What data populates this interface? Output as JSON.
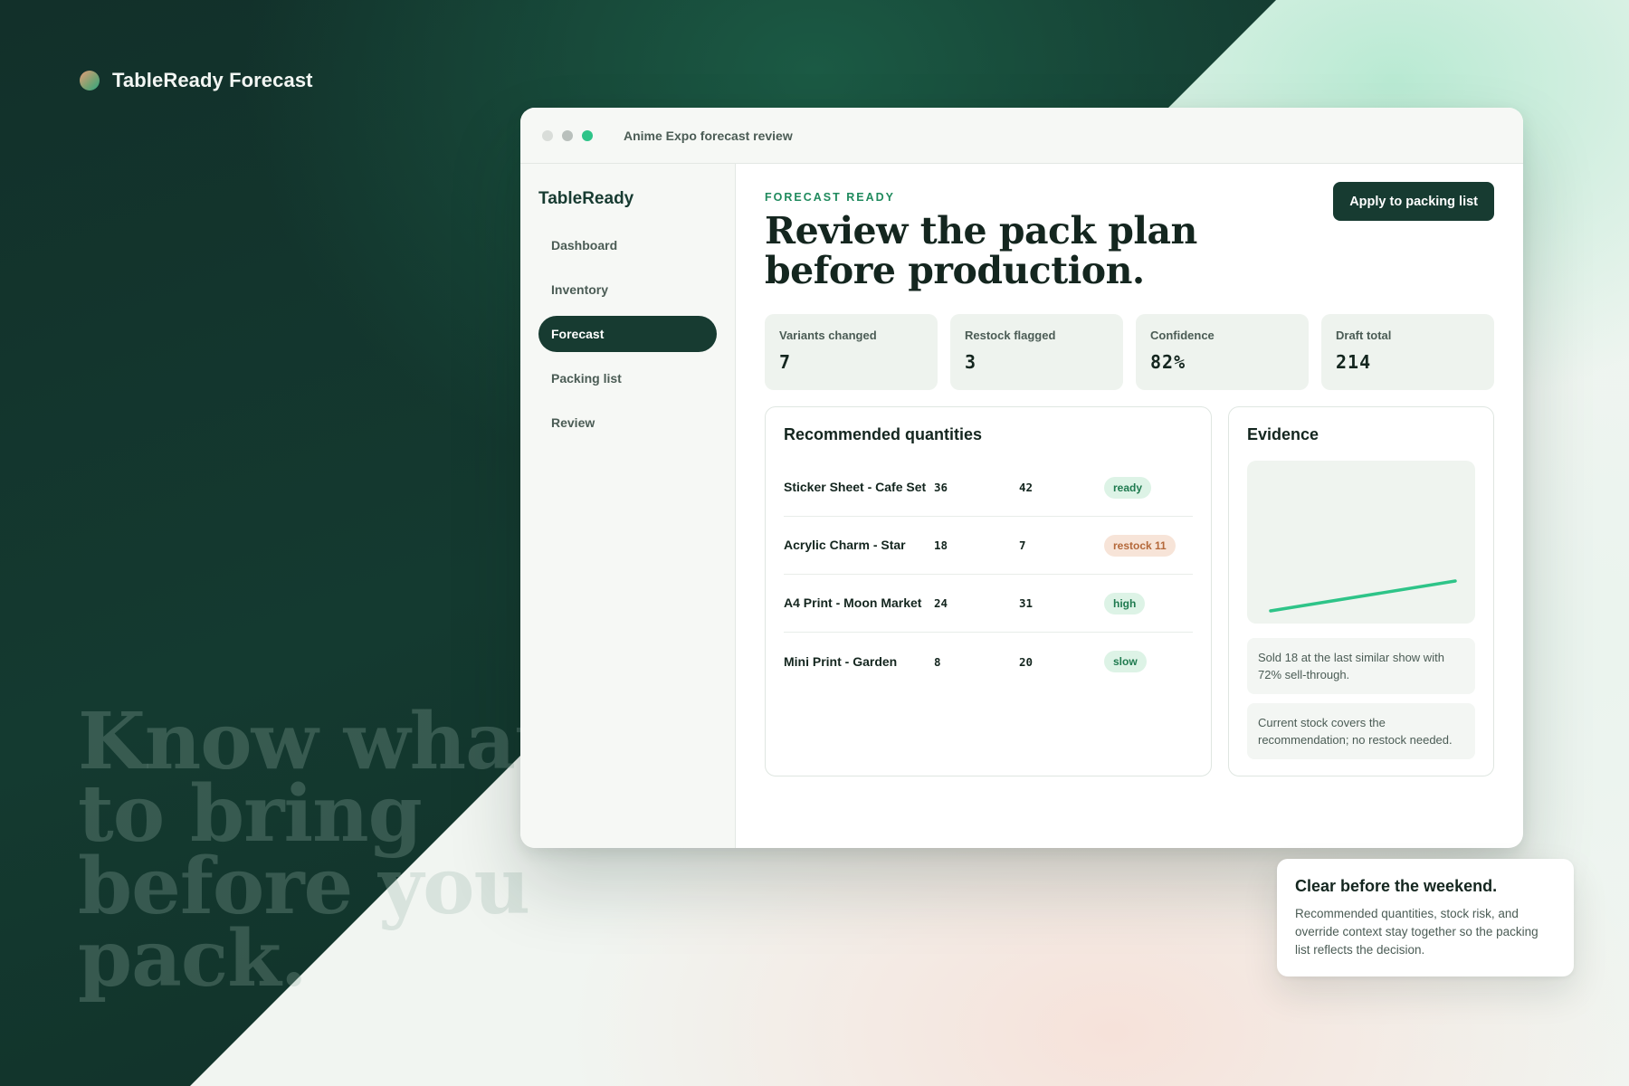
{
  "brand": {
    "name": "TableReady Forecast"
  },
  "hero": {
    "lines": [
      "Know what",
      "to bring",
      "before you",
      "pack."
    ]
  },
  "window": {
    "title": "Anime Expo forecast review"
  },
  "sidebar": {
    "brand": "TableReady",
    "items": [
      {
        "label": "Dashboard",
        "active": false
      },
      {
        "label": "Inventory",
        "active": false
      },
      {
        "label": "Forecast",
        "active": true
      },
      {
        "label": "Packing list",
        "active": false
      },
      {
        "label": "Review",
        "active": false
      }
    ]
  },
  "main": {
    "eyebrow": "FORECAST READY",
    "headline": "Review the pack plan before production.",
    "apply_label": "Apply to packing list",
    "stats": [
      {
        "label": "Variants changed",
        "value": "7"
      },
      {
        "label": "Restock flagged",
        "value": "3"
      },
      {
        "label": "Confidence",
        "value": "82%"
      },
      {
        "label": "Draft total",
        "value": "214"
      }
    ]
  },
  "recommended": {
    "title": "Recommended quantities",
    "rows": [
      {
        "name": "Sticker Sheet - Cafe Set",
        "a": "36",
        "b": "42",
        "status": "ready",
        "tone": "green"
      },
      {
        "name": "Acrylic Charm - Star",
        "a": "18",
        "b": "7",
        "status": "restock 11",
        "tone": "peach"
      },
      {
        "name": "A4 Print - Moon Market",
        "a": "24",
        "b": "31",
        "status": "high",
        "tone": "green"
      },
      {
        "name": "Mini Print - Garden",
        "a": "8",
        "b": "20",
        "status": "slow",
        "tone": "green"
      }
    ]
  },
  "evidence": {
    "title": "Evidence",
    "trend": [
      0.0,
      1.0
    ],
    "notes": [
      "Sold 18 at the last similar show with 72% sell-through.",
      "Current stock covers the recommendation; no restock needed."
    ]
  },
  "callout": {
    "title": "Clear before the weekend.",
    "body": "Recommended quantities, stock risk, and override context stay together so the packing list reflects the decision."
  },
  "colors": {
    "brand_dark": "#173b31",
    "accent_green": "#2ec488",
    "badge_green_bg": "#ddf3e6",
    "badge_peach_bg": "#f7e4d8"
  }
}
